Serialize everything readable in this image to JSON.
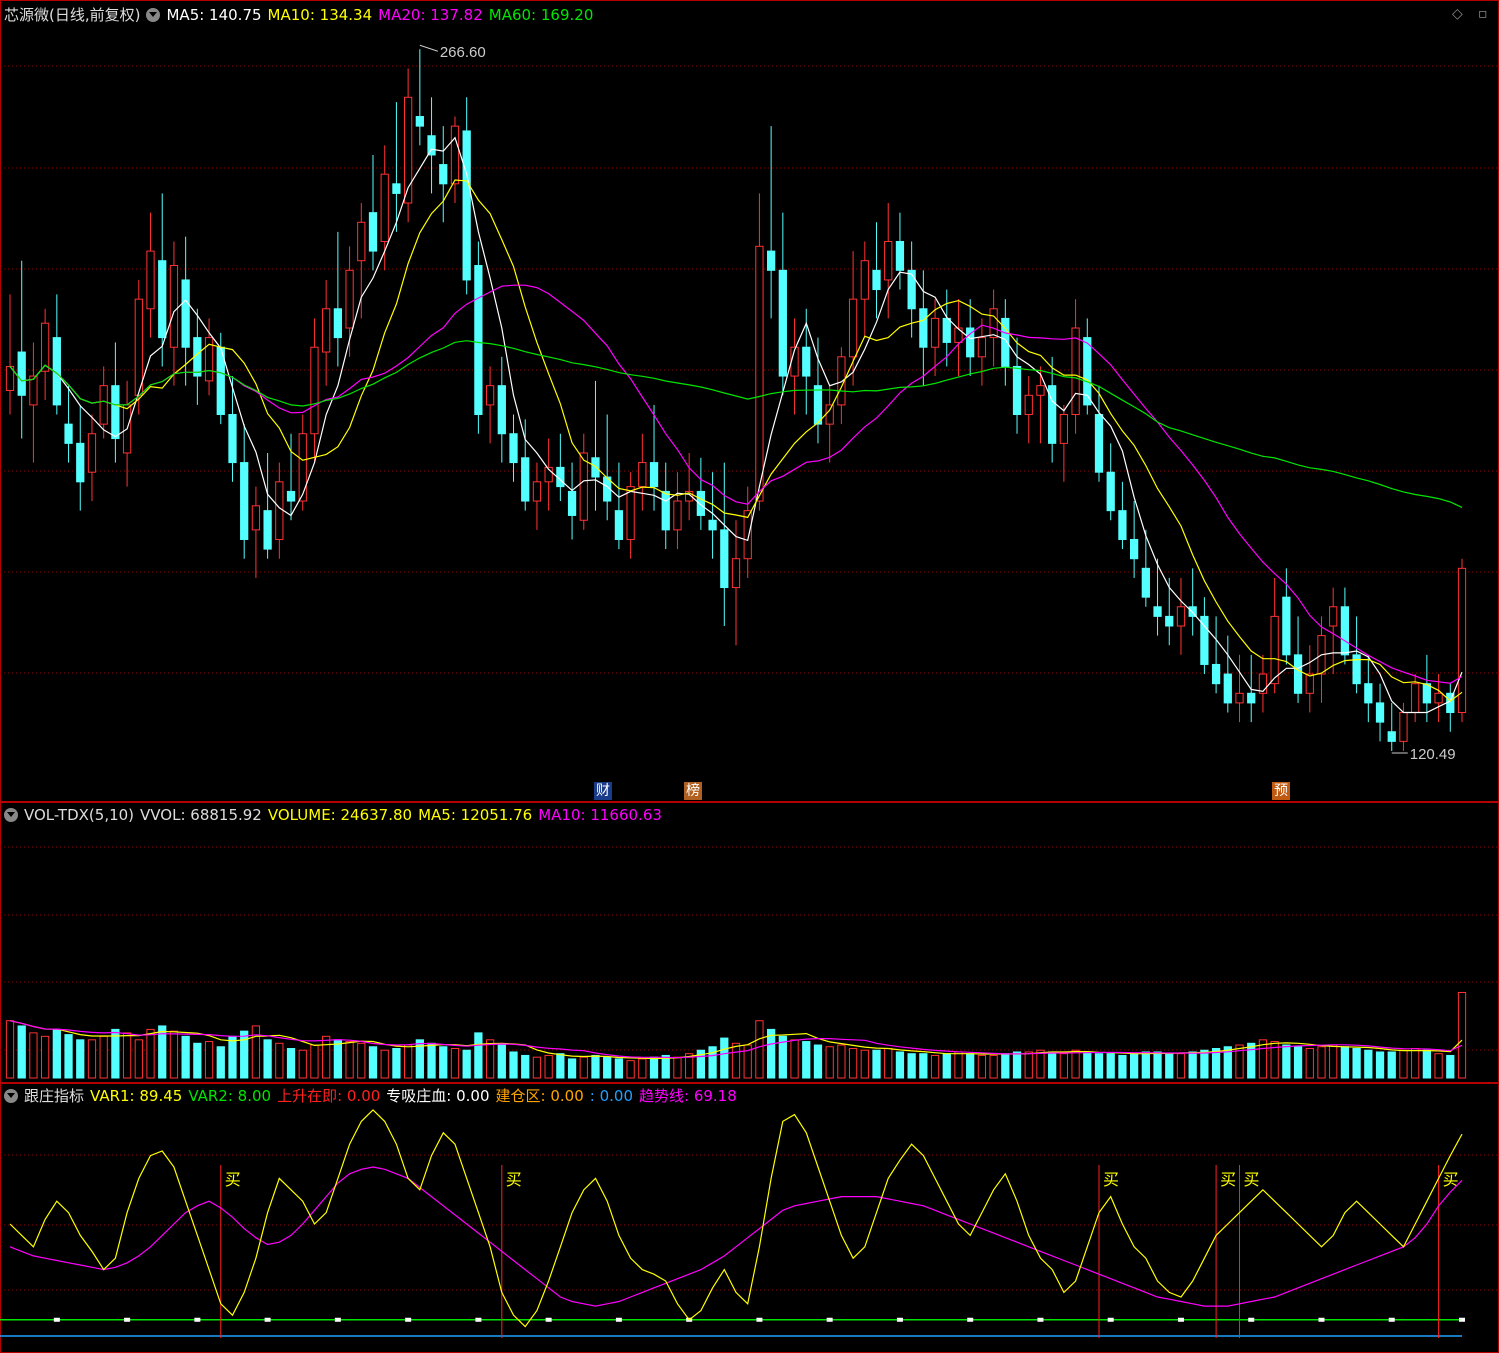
{
  "main_header": {
    "stock": "芯源微(日线,前复权)",
    "ma5": "MA5: 140.75",
    "ma10": "MA10: 134.34",
    "ma20": "MA20: 137.82",
    "ma60": "MA60: 169.20"
  },
  "vol_header": {
    "name": "VOL-TDX(5,10)",
    "vvol": "VVOL: 68815.92",
    "volume": "VOLUME: 24637.80",
    "ma5": "MA5: 12051.76",
    "ma10": "MA10: 11660.63"
  },
  "ind_header": {
    "name": "跟庄指标",
    "var1": "VAR1: 89.45",
    "var2": "VAR2: 8.00",
    "rise": "上升在即: 0.00",
    "absorb": "专吸庄血: 0.00",
    "build": "建仓区: 0.00",
    "blank": ": 0.00",
    "trend": "趋势线: 69.18"
  },
  "annotations": {
    "high": "266.60",
    "low": "120.49",
    "tag_cai": "财",
    "tag_bang": "榜",
    "tag_yu": "预",
    "buy": "买"
  },
  "colors": {
    "up": "#ff3232",
    "down": "#54ffff",
    "ma5": "#ffffff",
    "ma10": "#ffff00",
    "ma20": "#ff00ff",
    "ma60": "#00e600",
    "grid": "#8b0000",
    "border": "#b40000"
  },
  "chart_data": [
    {
      "type": "candlestick",
      "title": "芯源微(日线,前复权)",
      "ylim": [
        115,
        270
      ],
      "high_marker": 266.6,
      "low_marker": 120.49,
      "ohlc": [
        [
          195,
          215,
          190,
          200
        ],
        [
          203,
          222,
          185,
          194
        ],
        [
          192,
          205,
          180,
          198
        ],
        [
          199,
          212,
          193,
          209
        ],
        [
          206,
          215,
          190,
          192
        ],
        [
          188,
          196,
          180,
          184
        ],
        [
          184,
          192,
          170,
          176
        ],
        [
          178,
          190,
          172,
          186
        ],
        [
          188,
          200,
          185,
          196
        ],
        [
          196,
          205,
          180,
          185
        ],
        [
          182,
          197,
          175,
          192
        ],
        [
          194,
          218,
          190,
          214
        ],
        [
          212,
          232,
          206,
          224
        ],
        [
          222,
          236,
          200,
          206
        ],
        [
          204,
          226,
          196,
          221
        ],
        [
          218,
          227,
          196,
          204
        ],
        [
          206,
          212,
          192,
          198
        ],
        [
          197,
          210,
          194,
          206
        ],
        [
          204,
          207,
          188,
          190
        ],
        [
          190,
          198,
          176,
          180
        ],
        [
          180,
          188,
          160,
          164
        ],
        [
          166,
          175,
          156,
          171
        ],
        [
          170,
          182,
          160,
          162
        ],
        [
          164,
          180,
          160,
          176
        ],
        [
          174,
          186,
          168,
          172
        ],
        [
          172,
          190,
          170,
          186
        ],
        [
          186,
          210,
          180,
          204
        ],
        [
          203,
          218,
          196,
          212
        ],
        [
          212,
          228,
          200,
          206
        ],
        [
          208,
          225,
          202,
          220
        ],
        [
          222,
          234,
          210,
          230
        ],
        [
          232,
          244,
          220,
          224
        ],
        [
          226,
          246,
          220,
          240
        ],
        [
          238,
          255,
          228,
          236
        ],
        [
          234,
          262,
          230,
          256
        ],
        [
          252,
          266,
          246,
          250
        ],
        [
          248,
          256,
          236,
          244
        ],
        [
          242,
          250,
          230,
          238
        ],
        [
          238,
          252,
          234,
          250
        ],
        [
          249,
          256,
          215,
          218
        ],
        [
          221,
          226,
          186,
          190
        ],
        [
          192,
          200,
          184,
          196
        ],
        [
          196,
          202,
          180,
          186
        ],
        [
          186,
          190,
          176,
          180
        ],
        [
          181,
          189,
          170,
          172
        ],
        [
          172,
          180,
          166,
          176
        ],
        [
          176,
          185,
          170,
          179
        ],
        [
          179,
          186,
          172,
          175
        ],
        [
          174,
          180,
          164,
          169
        ],
        [
          168,
          186,
          166,
          182
        ],
        [
          181,
          197,
          170,
          177
        ],
        [
          177,
          190,
          168,
          172
        ],
        [
          170,
          180,
          162,
          164
        ],
        [
          164,
          178,
          160,
          175
        ],
        [
          175,
          186,
          170,
          180
        ],
        [
          180,
          192,
          170,
          175
        ],
        [
          174,
          180,
          162,
          166
        ],
        [
          166,
          178,
          162,
          172
        ],
        [
          172,
          182,
          168,
          174
        ],
        [
          174,
          181,
          166,
          169
        ],
        [
          168,
          178,
          160,
          166
        ],
        [
          166,
          180,
          146,
          154
        ],
        [
          154,
          168,
          142,
          160
        ],
        [
          160,
          175,
          156,
          170
        ],
        [
          172,
          236,
          170,
          225
        ],
        [
          224,
          250,
          210,
          220
        ],
        [
          220,
          232,
          194,
          198
        ],
        [
          198,
          210,
          190,
          204
        ],
        [
          204,
          212,
          190,
          198
        ],
        [
          196,
          206,
          184,
          188
        ],
        [
          188,
          196,
          180,
          192
        ],
        [
          192,
          204,
          188,
          202
        ],
        [
          202,
          224,
          196,
          214
        ],
        [
          214,
          226,
          206,
          222
        ],
        [
          220,
          230,
          210,
          216
        ],
        [
          218,
          234,
          210,
          226
        ],
        [
          226,
          232,
          216,
          220
        ],
        [
          220,
          226,
          206,
          212
        ],
        [
          212,
          220,
          196,
          204
        ],
        [
          204,
          214,
          198,
          210
        ],
        [
          210,
          216,
          200,
          205
        ],
        [
          205,
          214,
          198,
          208
        ],
        [
          208,
          214,
          198,
          202
        ],
        [
          202,
          210,
          196,
          206
        ],
        [
          206,
          216,
          200,
          212
        ],
        [
          210,
          214,
          196,
          200
        ],
        [
          200,
          206,
          186,
          190
        ],
        [
          190,
          198,
          184,
          194
        ],
        [
          194,
          200,
          184,
          196
        ],
        [
          196,
          202,
          180,
          184
        ],
        [
          184,
          192,
          176,
          190
        ],
        [
          190,
          214,
          186,
          208
        ],
        [
          206,
          210,
          190,
          192
        ],
        [
          190,
          196,
          176,
          178
        ],
        [
          178,
          184,
          168,
          170
        ],
        [
          170,
          176,
          162,
          164
        ],
        [
          164,
          172,
          156,
          160
        ],
        [
          158,
          166,
          150,
          152
        ],
        [
          150,
          160,
          144,
          148
        ],
        [
          148,
          156,
          142,
          146
        ],
        [
          146,
          156,
          140,
          150
        ],
        [
          150,
          158,
          144,
          148
        ],
        [
          148,
          152,
          136,
          138
        ],
        [
          138,
          148,
          132,
          134
        ],
        [
          136,
          144,
          128,
          130
        ],
        [
          130,
          140,
          126,
          132
        ],
        [
          132,
          140,
          126,
          130
        ],
        [
          132,
          140,
          128,
          136
        ],
        [
          134,
          156,
          132,
          148
        ],
        [
          152,
          158,
          138,
          140
        ],
        [
          140,
          148,
          130,
          132
        ],
        [
          132,
          142,
          128,
          136
        ],
        [
          136,
          148,
          130,
          144
        ],
        [
          146,
          154,
          136,
          150
        ],
        [
          150,
          154,
          138,
          140
        ],
        [
          140,
          148,
          132,
          134
        ],
        [
          134,
          140,
          126,
          130
        ],
        [
          130,
          134,
          122,
          126
        ],
        [
          124,
          130,
          120,
          122
        ],
        [
          122,
          130,
          120,
          128
        ],
        [
          128,
          136,
          126,
          134
        ],
        [
          134,
          140,
          126,
          130
        ],
        [
          130,
          136,
          126,
          132
        ],
        [
          132,
          134,
          124,
          128
        ],
        [
          128,
          160,
          126,
          158
        ]
      ]
    },
    {
      "type": "bar",
      "title": "VOL-TDX(5,10)",
      "ylim": [
        0,
        70000
      ],
      "values": [
        16500,
        15000,
        13000,
        12000,
        14000,
        12500,
        11000,
        11000,
        12000,
        14000,
        13000,
        11000,
        14000,
        15000,
        13500,
        12000,
        10000,
        10500,
        9000,
        12000,
        13500,
        15000,
        11000,
        10000,
        8500,
        8000,
        9500,
        12000,
        11000,
        10500,
        10000,
        9000,
        8000,
        8500,
        9500,
        11000,
        10000,
        9000,
        8500,
        8000,
        13000,
        11000,
        9500,
        7500,
        6500,
        6000,
        6500,
        7000,
        5500,
        6000,
        6500,
        6000,
        5500,
        5000,
        5500,
        6000,
        6500,
        6000,
        7000,
        8000,
        9000,
        11500,
        10000,
        9500,
        16500,
        14000,
        12000,
        11000,
        10500,
        9500,
        9000,
        9500,
        8500,
        8000,
        8000,
        8500,
        7500,
        7000,
        7000,
        6500,
        7000,
        7500,
        7000,
        6500,
        6500,
        7000,
        7500,
        7500,
        8000,
        7500,
        7000,
        8000,
        7500,
        7000,
        7000,
        6500,
        7000,
        7500,
        7500,
        7000,
        7000,
        7500,
        8000,
        8500,
        9000,
        9500,
        10000,
        11000,
        10500,
        9500,
        9000,
        8500,
        9000,
        9500,
        9000,
        8500,
        8000,
        7500,
        7500,
        8000,
        8500,
        8000,
        7000,
        6500,
        24637.8
      ],
      "vvol": 68815.92,
      "ma5": 12051.76,
      "ma10": 11660.63
    },
    {
      "type": "line",
      "title": "跟庄指标",
      "ylim": [
        0,
        100
      ],
      "series": [
        {
          "name": "VAR1",
          "values": [
            50,
            45,
            40,
            52,
            60,
            55,
            45,
            38,
            30,
            35,
            55,
            70,
            80,
            82,
            75,
            60,
            45,
            30,
            15,
            10,
            20,
            35,
            55,
            70,
            65,
            60,
            50,
            55,
            70,
            85,
            95,
            100,
            95,
            85,
            70,
            65,
            80,
            90,
            85,
            70,
            55,
            40,
            20,
            10,
            5,
            12,
            25,
            40,
            55,
            65,
            70,
            60,
            45,
            35,
            30,
            28,
            25,
            15,
            8,
            12,
            22,
            30,
            20,
            15,
            40,
            70,
            95,
            98,
            90,
            75,
            60,
            45,
            35,
            40,
            55,
            70,
            78,
            85,
            80,
            70,
            60,
            50,
            45,
            55,
            65,
            72,
            60,
            45,
            35,
            30,
            20,
            25,
            40,
            55,
            62,
            50,
            40,
            35,
            25,
            20,
            18,
            25,
            35,
            45,
            50,
            55,
            60,
            65,
            60,
            55,
            50,
            45,
            40,
            45,
            55,
            60,
            55,
            50,
            45,
            40,
            50,
            60,
            70,
            80,
            89.45
          ]
        },
        {
          "name": "趋势线",
          "values": [
            40,
            38,
            36,
            35,
            34,
            33,
            32,
            31,
            30,
            31,
            33,
            36,
            40,
            45,
            50,
            55,
            58,
            60,
            57,
            53,
            48,
            44,
            41,
            42,
            45,
            50,
            56,
            62,
            68,
            72,
            74,
            75,
            74,
            72,
            70,
            66,
            62,
            58,
            54,
            50,
            46,
            42,
            38,
            34,
            30,
            26,
            22,
            18,
            16,
            15,
            14,
            15,
            16,
            18,
            20,
            22,
            24,
            26,
            28,
            30,
            33,
            36,
            40,
            44,
            48,
            52,
            56,
            58,
            59,
            60,
            61,
            62,
            62,
            62,
            62,
            61,
            60,
            59,
            58,
            56,
            54,
            52,
            50,
            48,
            46,
            44,
            42,
            40,
            38,
            36,
            34,
            32,
            30,
            28,
            26,
            24,
            22,
            20,
            18,
            17,
            16,
            15,
            14,
            14,
            14,
            15,
            16,
            17,
            18,
            20,
            22,
            24,
            26,
            28,
            30,
            32,
            34,
            36,
            38,
            40,
            44,
            50,
            58,
            64,
            69.18
          ]
        }
      ],
      "var1": 89.45,
      "var2": 8.0,
      "buy_signals": [
        31,
        71,
        157,
        174,
        178,
        208
      ]
    }
  ]
}
